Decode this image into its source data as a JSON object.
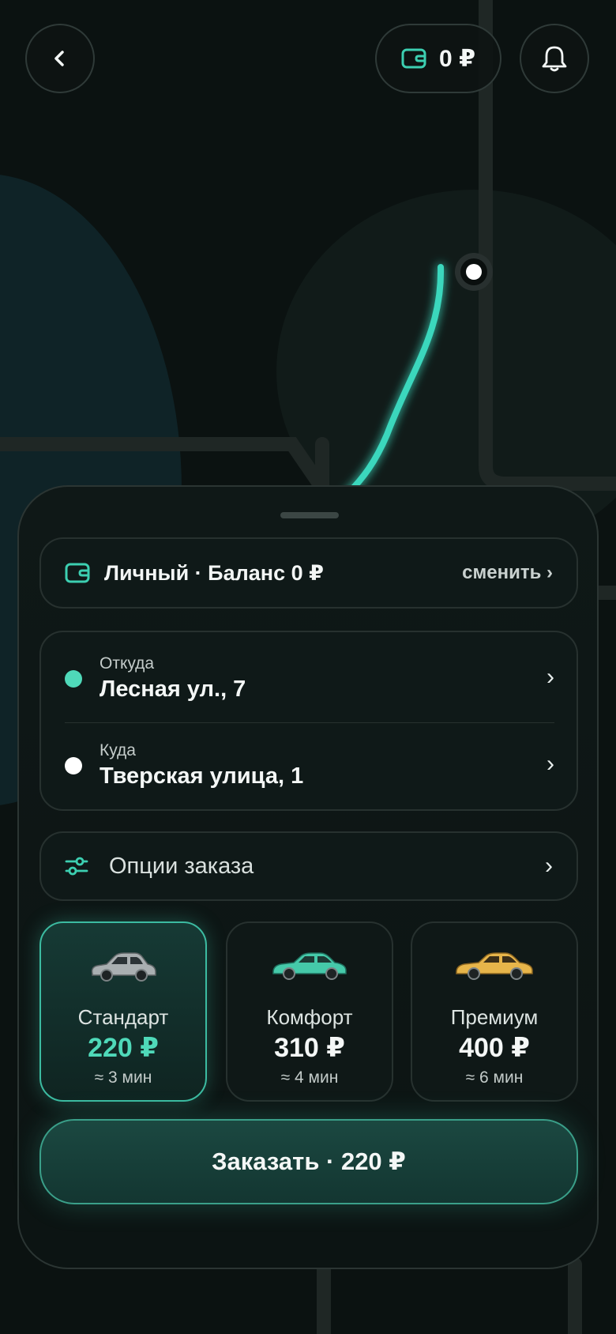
{
  "header": {
    "back_icon": "chevron-left-icon",
    "wallet_amount": "0 ₽",
    "wallet_icon": "wallet-icon",
    "bell_icon": "bell-icon"
  },
  "account": {
    "label": "Личный · Баланс 0 ₽",
    "change": "сменить ›"
  },
  "route": {
    "from_label": "Откуда",
    "from_value": "Лесная ул., 7",
    "to_label": "Куда",
    "to_value": "Тверская улица, 1",
    "chevron": "›"
  },
  "options": {
    "label": "Опции заказа",
    "chevron": "›"
  },
  "tariffs": [
    {
      "name": "Стандарт",
      "price": "220 ₽",
      "eta": "≈ 3 мин",
      "car_color": "#a9afb1",
      "selected": true
    },
    {
      "name": "Комфорт",
      "price": "310 ₽",
      "eta": "≈ 4 мин",
      "car_color": "#45c9a9",
      "selected": false
    },
    {
      "name": "Премиум",
      "price": "400 ₽",
      "eta": "≈ 6 мин",
      "car_color": "#e7b54a",
      "selected": false
    }
  ],
  "order_button": "Заказать · 220 ₽",
  "colors": {
    "accent": "#3cbba1",
    "accent_text": "#4fd9b9",
    "background": "#0b1211"
  }
}
